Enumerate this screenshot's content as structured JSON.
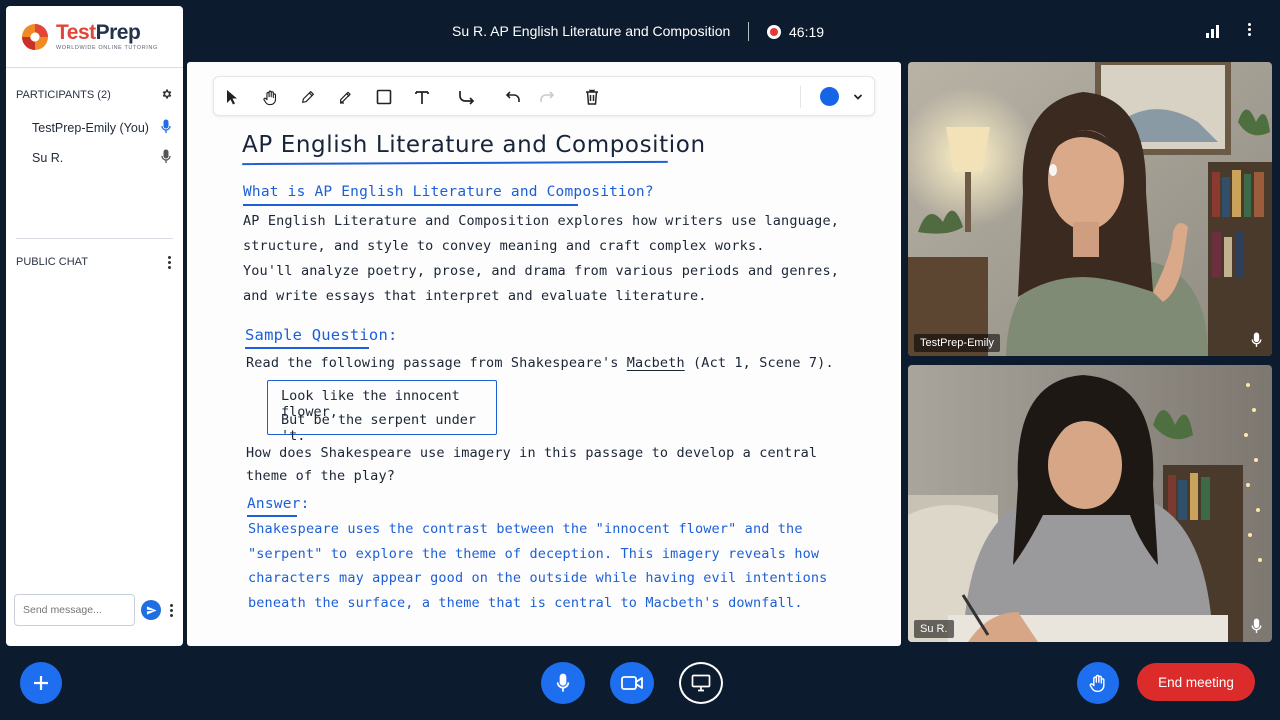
{
  "brand": {
    "name_part1": "Test",
    "name_part2": "Prep",
    "tagline": "WORLDWIDE  ONLINE  TUTORING",
    "colors": {
      "accent": "#e2463a",
      "dark": "#24324a"
    }
  },
  "topbar": {
    "title": "Su R.  AP English Literature and Composition",
    "timer": "46:19",
    "icons": [
      "record-icon",
      "signal-icon",
      "more-icon"
    ]
  },
  "sidebar": {
    "participants_label": "PARTICIPANTS (2)",
    "participants": [
      {
        "name": "TestPrep-Emily (You)",
        "mic": "active"
      },
      {
        "name": "Su R.",
        "mic": "muted-gray"
      }
    ],
    "chat_label": "PUBLIC CHAT",
    "send_placeholder": "Send message..."
  },
  "whiteboard": {
    "tools": [
      "select-tool",
      "pan-tool",
      "pencil-tool",
      "highlighter-tool",
      "rectangle-tool",
      "text-tool",
      "connector-tool",
      "undo-tool",
      "redo-tool",
      "delete-tool"
    ],
    "active_color": "#1565e6",
    "title": "AP English Literature and Composition",
    "heading1": "What is AP English Literature and Composition?",
    "intro_lines": [
      "AP English Literature and Composition explores how writers use language,",
      "structure, and style to convey meaning and craft complex works.",
      "You'll analyze poetry, prose, and drama from various periods and genres,",
      "and write essays that interpret and evaluate literature."
    ],
    "heading2": "Sample Question:",
    "prompt_before": "Read the following passage from Shakespeare's ",
    "prompt_work": "Macbeth",
    "prompt_after": " (Act 1, Scene 7).",
    "quote_lines": [
      "Look like the innocent flower,",
      "But be the serpent under 't."
    ],
    "question_lines": [
      "How does Shakespeare use imagery in this passage to develop a central",
      "theme of the play?"
    ],
    "answer_label": "Answer:",
    "answer_lines": [
      "Shakespeare uses the contrast between the \"innocent flower\" and the",
      "\"serpent\" to explore the theme of deception. This imagery reveals how",
      "characters may appear good on the outside while having evil intentions",
      "beneath the surface, a theme that is central to Macbeth's downfall."
    ]
  },
  "videos": [
    {
      "name": "TestPrep-Emily"
    },
    {
      "name": "Su R."
    }
  ],
  "controls": {
    "end_label": "End meeting",
    "colors": {
      "primary": "#1e6ff0",
      "danger": "#dc2b2b"
    }
  }
}
